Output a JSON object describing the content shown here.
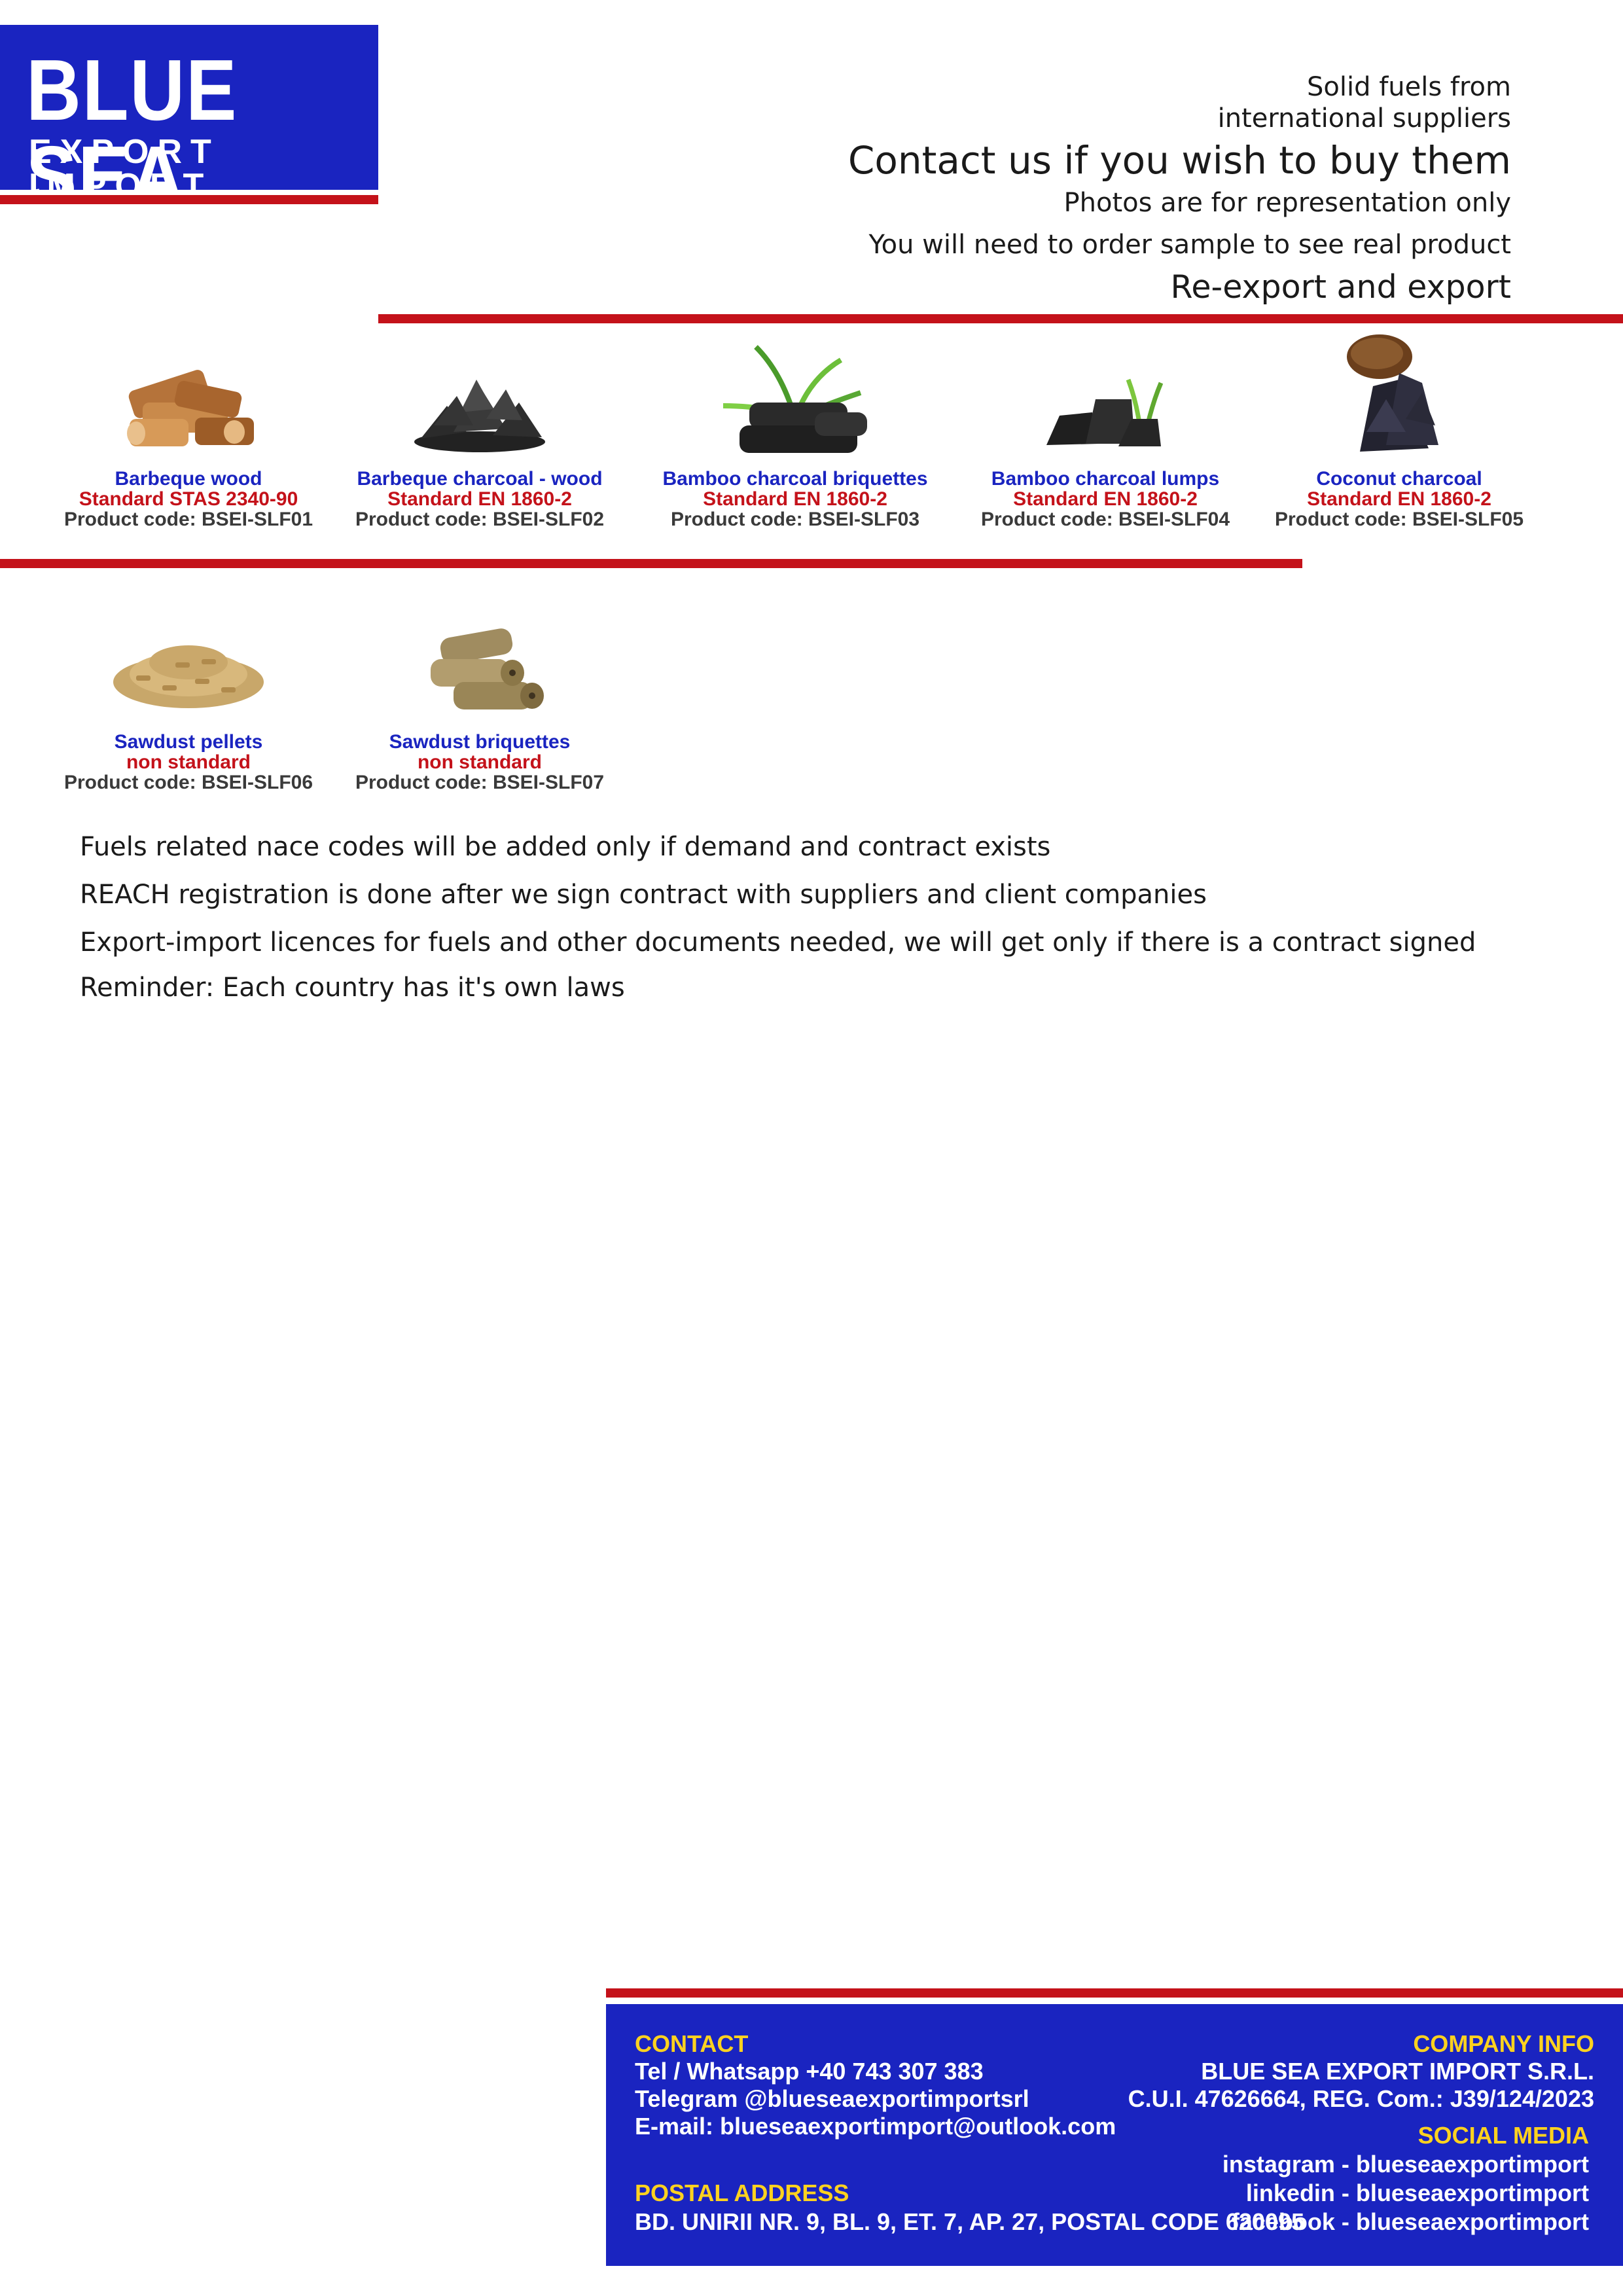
{
  "logo": {
    "title": "BLUE SEA",
    "subtitle": "EXPORT IMPORT"
  },
  "header": {
    "line1": "Solid fuels from",
    "line2": "international suppliers",
    "line3": "Contact us if you wish to buy them",
    "line4": "Photos are for representation only",
    "line5": "You will need to order sample to see real product",
    "line6": "Re-export and export"
  },
  "products": [
    {
      "name": "Barbeque wood",
      "standard": "Standard STAS 2340-90",
      "code": "Product code: BSEI-SLF01",
      "icon": "firewood-icon"
    },
    {
      "name": "Barbeque charcoal - wood",
      "standard": "Standard EN 1860-2",
      "code": "Product code: BSEI-SLF02",
      "icon": "charcoal-pile-icon"
    },
    {
      "name": "Bamboo  charcoal briquettes",
      "standard": "Standard EN 1860-2",
      "code": "Product code: BSEI-SLF03",
      "icon": "bamboo-briquettes-icon"
    },
    {
      "name": "Bamboo charcoal lumps",
      "standard": "Standard EN 1860-2",
      "code": "Product code: BSEI-SLF04",
      "icon": "bamboo-lumps-icon"
    },
    {
      "name": "Coconut charcoal",
      "standard": "Standard EN 1860-2",
      "code": "Product code: BSEI-SLF05",
      "icon": "coconut-charcoal-icon"
    },
    {
      "name": "Sawdust pellets",
      "standard": "non standard",
      "code": "Product code: BSEI-SLF06",
      "icon": "pellets-icon"
    },
    {
      "name": "Sawdust briquettes",
      "standard": "non standard",
      "code": "Product code: BSEI-SLF07",
      "icon": "sawdust-briquettes-icon"
    }
  ],
  "notes": [
    "Fuels related nace codes will be added only if demand and contract exists",
    "REACH registration is done after we sign contract with suppliers and client companies",
    "Export-import licences for fuels and other documents needed, we will get only if there is a contract signed",
    "Reminder: Each country has it's own laws"
  ],
  "footer": {
    "contact_heading": "CONTACT",
    "phone": "Tel / Whatsapp +40 743 307 383",
    "telegram": "Telegram @blueseaexportimportsrl",
    "email": "E-mail: blueseaexportimport@outlook.com",
    "postal_heading": "POSTAL ADDRESS",
    "address": "BD. UNIRII NR. 9, BL. 9, ET. 7, AP. 27, POSTAL CODE 620095",
    "company_heading": "COMPANY INFO",
    "company_name": "BLUE SEA EXPORT IMPORT S.R.L.",
    "company_ids": "C.U.I. 47626664, REG. Com.: J39/124/2023",
    "social_heading": "SOCIAL MEDIA",
    "instagram": "instagram - blueseaexportimport",
    "linkedin": "linkedin - blueseaexportimport",
    "facebook": "facebook - blueseaexportimport"
  },
  "colors": {
    "brand_blue": "#1a24c0",
    "accent_red": "#c4121a",
    "footer_heading": "#ffd21f"
  }
}
